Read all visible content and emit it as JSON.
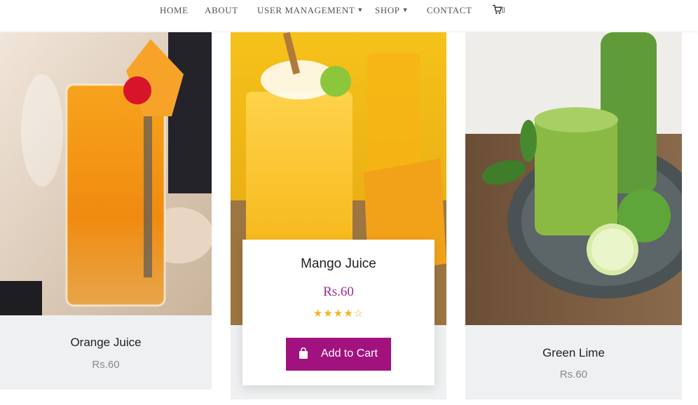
{
  "nav": {
    "items": [
      {
        "label": "HOME"
      },
      {
        "label": "ABOUT"
      },
      {
        "label": "USER MANAGEMENT",
        "dropdown": true
      },
      {
        "label": "SHOP",
        "dropdown": true
      },
      {
        "label": "CONTACT"
      }
    ],
    "cart_icon": "cart-icon",
    "cart_count": "[]"
  },
  "products": [
    {
      "name": "Orange Juice",
      "price": "Rs.60"
    },
    {
      "name": "Mango Juice",
      "price": "Rs.60",
      "rating": 4,
      "rating_max": 5,
      "button": "Add to Cart"
    },
    {
      "name": "Green Lime",
      "price": "Rs.60"
    }
  ],
  "colors": {
    "accent": "#a2127f",
    "price_accent": "#9b2d8e",
    "star": "#f5b325",
    "card_bg": "#eff0f1"
  }
}
